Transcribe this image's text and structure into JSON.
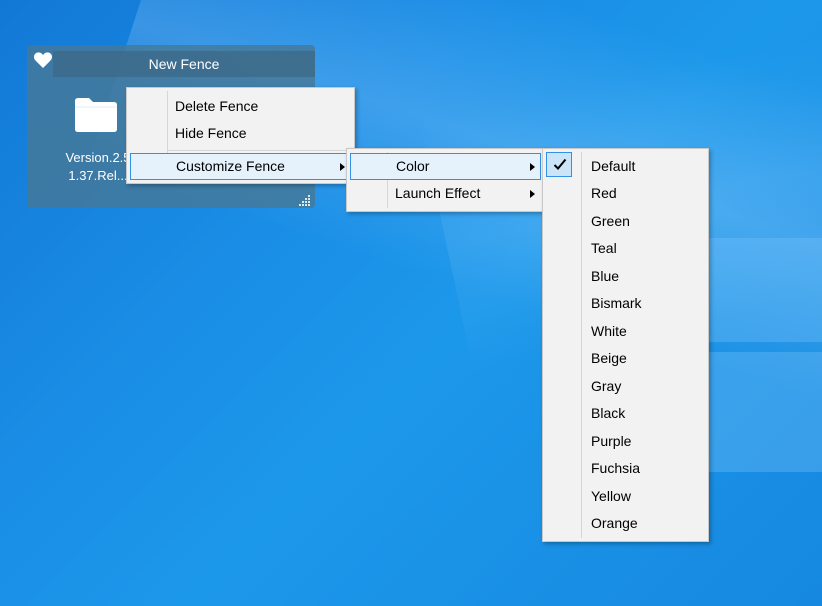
{
  "fence": {
    "title": "New Fence",
    "file_label_line1": "Version.2.5",
    "file_label_line2": "1.37.Rel..."
  },
  "context_menu": {
    "items": [
      {
        "label": "Delete Fence"
      },
      {
        "label": "Hide Fence"
      },
      {
        "label": "Customize Fence",
        "has_submenu": true,
        "highlighted": true
      }
    ]
  },
  "customize_submenu": {
    "items": [
      {
        "label": "Color",
        "has_submenu": true,
        "highlighted": true
      },
      {
        "label": "Launch Effect",
        "has_submenu": true
      }
    ]
  },
  "color_submenu": {
    "selected": "Default",
    "items": [
      {
        "label": "Default"
      },
      {
        "label": "Red"
      },
      {
        "label": "Green"
      },
      {
        "label": "Teal"
      },
      {
        "label": "Blue"
      },
      {
        "label": "Bismark"
      },
      {
        "label": "White"
      },
      {
        "label": "Beige"
      },
      {
        "label": "Gray"
      },
      {
        "label": "Black"
      },
      {
        "label": "Purple"
      },
      {
        "label": "Fuchsia"
      },
      {
        "label": "Yellow"
      },
      {
        "label": "Orange"
      }
    ]
  },
  "icons": {
    "fence_header_icon": "heart-icon",
    "file_icon": "folder-icon",
    "resize": "resize-grip-icon",
    "check": "checkmark-icon",
    "submenu_arrow": "chevron-right-icon"
  },
  "colors": {
    "desktop_blue": "#1a8ee6",
    "fence_bg": "#46789680",
    "menu_bg": "#f2f2f2",
    "highlight_border": "#3390e8",
    "highlight_bg": "#e5f1fb"
  }
}
